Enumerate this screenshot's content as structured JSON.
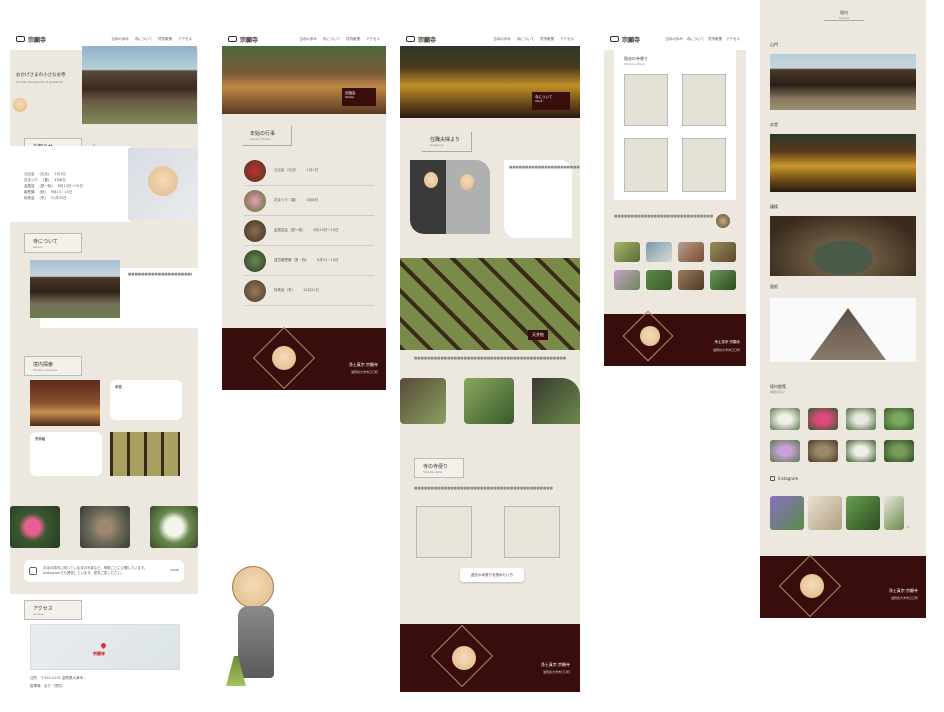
{
  "site": {
    "name": "宗願寺"
  },
  "nav": [
    {
      "jp": "当寺の歩み",
      "en": "Introduction"
    },
    {
      "jp": "寺について",
      "en": "about"
    },
    {
      "jp": "境内散策",
      "en": "Explore temple"
    },
    {
      "jp": "アクセス",
      "en": "Access"
    }
  ],
  "col1": {
    "hero_text": "おかげさまの小さなお寺",
    "hero_sub": "A small temple full of gratitude",
    "news_title": "お知らせ",
    "news_sub": "Information",
    "news_items": [
      {
        "label": "元旦会",
        "tag": "(元旦)",
        "date": "1月1日"
      },
      {
        "label": "花まつり",
        "tag": "(春)",
        "date": "4月8日"
      },
      {
        "label": "盂蘭盆",
        "tag": "(夏〜秋)",
        "date": "8月13日〜15日"
      },
      {
        "label": "報恩講",
        "tag": "(秋)",
        "date": "9月14・15日"
      },
      {
        "label": "除夜会",
        "tag": "(冬)",
        "date": "12月31日"
      }
    ],
    "about_title": "寺について",
    "about_sub": "About",
    "explore_title": "境内探索",
    "explore_sub": "Explore temples",
    "card1_title": "本堂",
    "card2_title": "天井絵",
    "insta_text": "お寺の境内に咲いている花の写真など、季節ごとに公開しています。Instagramでも発信しています。是非ご覧ください。",
    "insta_link": "more",
    "access_title": "アクセス",
    "access_sub": "Access",
    "map_label": "宗願寺",
    "addr1": "住所　〒520-2131 滋賀県大津市...",
    "addr2": "駐車場　あり（境内）"
  },
  "col2": {
    "hero_caption": "初詣会",
    "hero_caption_en": "Temple",
    "events_title": "年始の行事",
    "events_sub": "Season Event",
    "events": [
      {
        "name": "元旦会（元旦）",
        "date": "1月1日"
      },
      {
        "name": "花まつり（春）",
        "date": "4月8日"
      },
      {
        "name": "盂蘭盆会（夏〜秋）",
        "date": "8月13日〜15日"
      },
      {
        "name": "遠忌報恩講（夏・秋）",
        "date": "9月14・15日"
      },
      {
        "name": "除夜会（冬）",
        "date": "12月31日"
      }
    ],
    "footer_name": "浄土真宗 宗願寺",
    "footer_addr": "滋賀県大津市〇〇町"
  },
  "col3": {
    "hero_caption": "寺について",
    "hero_caption_en": "About",
    "greeting_title": "住職夫婦より",
    "greeting_sub": "Greeting",
    "ceiling_caption": "天井絵",
    "letters_title": "寺の寺便り",
    "letters_sub": "Temple letter",
    "letters_btn": "過去の寺便りを読みたい方",
    "footer_name": "浄土真宗 宗願寺",
    "footer_addr": "滋賀県大津市〇〇町"
  },
  "col4": {
    "letters_title": "過去の寺便り",
    "letters_sub": "Temple letters",
    "footer_name": "浄土真宗 宗願寺",
    "footer_addr": "滋賀県大津市〇〇町"
  },
  "col5": {
    "top_title": "境内",
    "top_sub": "Temple",
    "caption1": "山門",
    "caption2": "本堂",
    "caption3": "鐘楼",
    "caption4": "屋根",
    "flowers_title": "境内散策",
    "flowers_sub": "季節の花々",
    "insta_title": "Instagram",
    "footer_name": "浄土真宗 宗願寺",
    "footer_addr": "滋賀県大津市〇〇町"
  }
}
